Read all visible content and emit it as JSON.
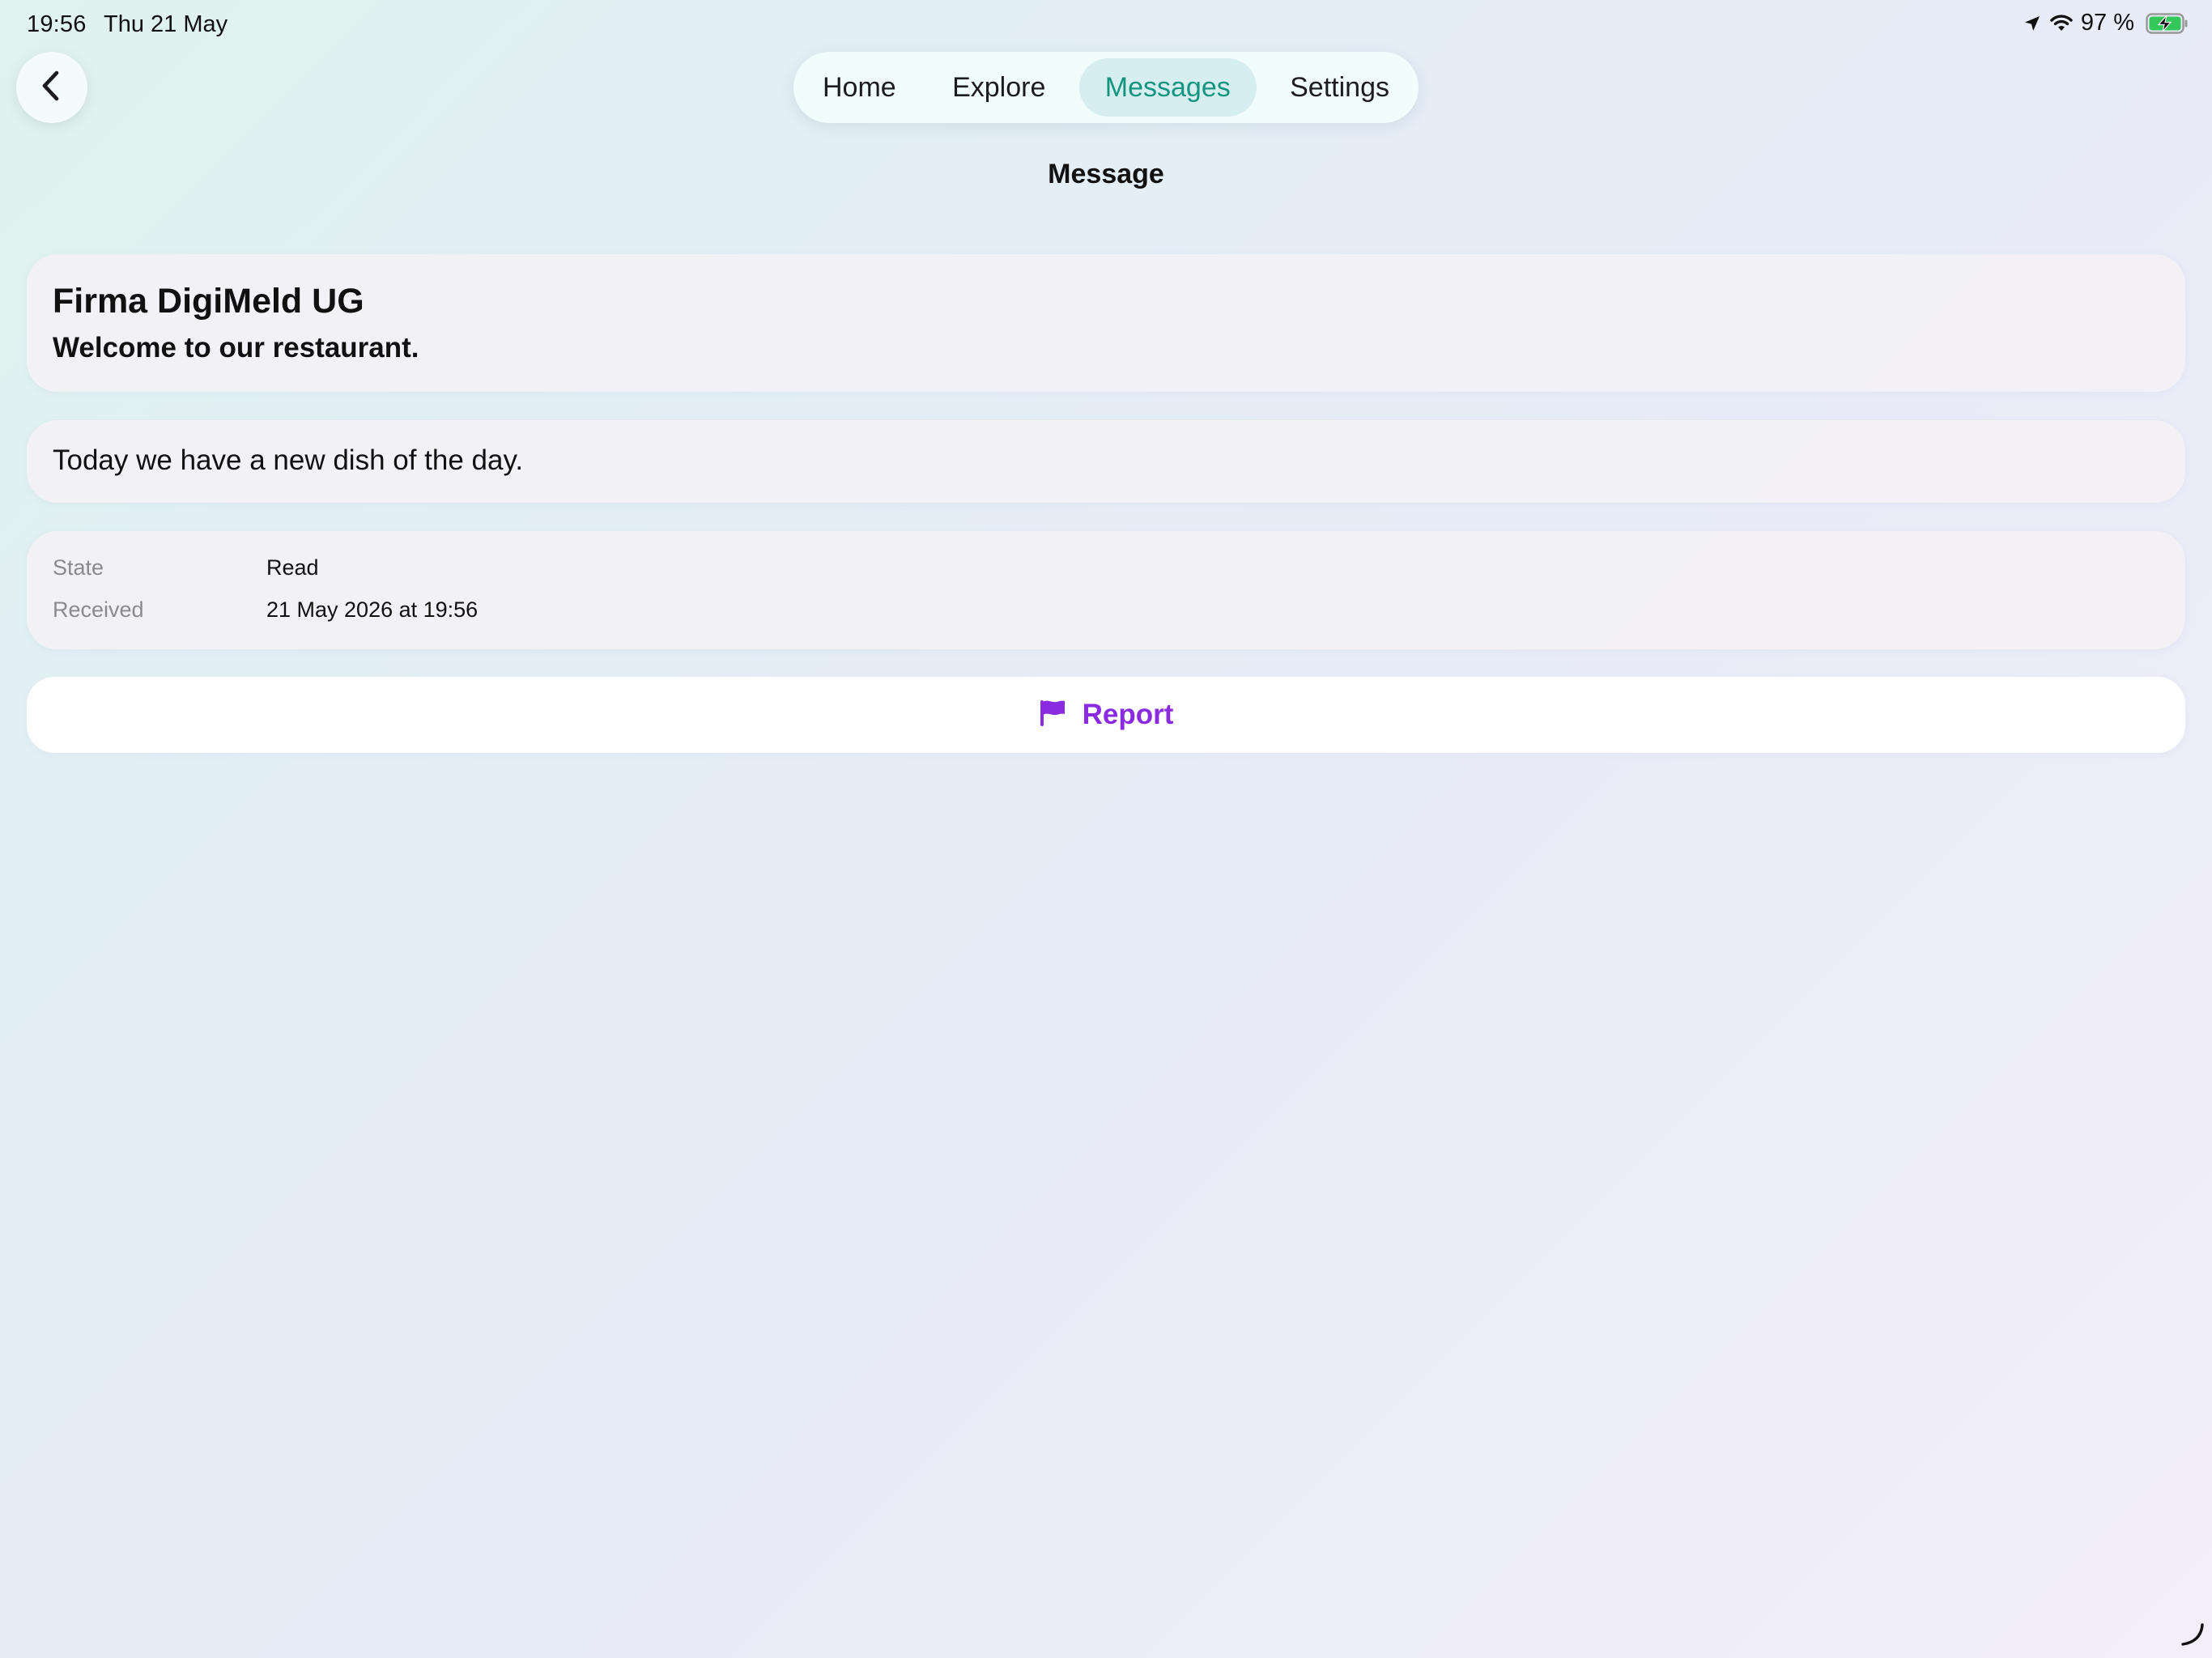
{
  "status_bar": {
    "time": "19:56",
    "date": "Thu 21 May",
    "battery_percent": "97 %",
    "icons": [
      "location-arrow-icon",
      "wifi-icon",
      "battery-charging-icon"
    ],
    "battery_color": "#34c759"
  },
  "navigation": {
    "back_icon": "chevron-left-icon",
    "tabs": [
      {
        "label": "Home",
        "active": false
      },
      {
        "label": "Explore",
        "active": false
      },
      {
        "label": "Messages",
        "active": true
      },
      {
        "label": "Settings",
        "active": false
      }
    ],
    "active_color": "#13957f",
    "title": "Message"
  },
  "message": {
    "sender": "Firma DigiMeld UG",
    "subject": "Welcome to our restaurant.",
    "body": "Today we have a new dish of the day.",
    "details": [
      {
        "label": "State",
        "value": "Read"
      },
      {
        "label": "Received",
        "value": "21 May 2026 at 19:56"
      }
    ]
  },
  "actions": {
    "report_label": "Report",
    "report_icon": "flag-icon",
    "report_color": "#8a2be2"
  }
}
